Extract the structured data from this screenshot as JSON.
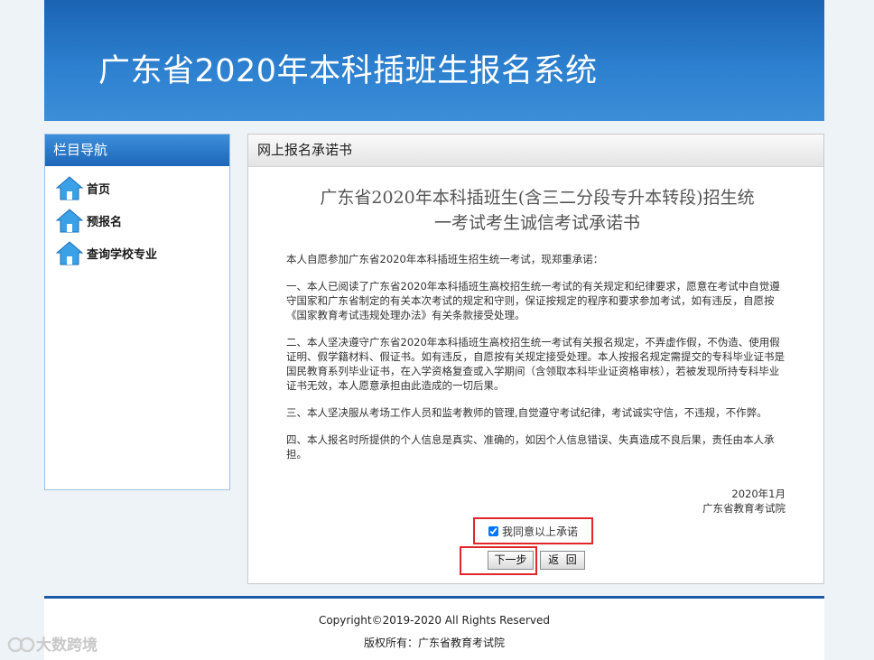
{
  "header": {
    "title": "广东省2020年本科插班生报名系统"
  },
  "nav": {
    "title": "栏目导航",
    "items": [
      {
        "label": "首页",
        "icon": "home-icon"
      },
      {
        "label": "预报名",
        "icon": "home-icon"
      },
      {
        "label": "查询学校专业",
        "icon": "home-icon"
      }
    ]
  },
  "panel": {
    "title": "网上报名承诺书",
    "doc_title_line1": "广东省2020年本科插班生(含三二分段专升本转段)招生统",
    "doc_title_line2": "一考试考生诚信考试承诺书",
    "paragraphs": [
      "本人自愿参加广东省2020年本科插班生招生统一考试，现郑重承诺：",
      "一、本人已阅读了广东省2020年本科插班生高校招生统一考试的有关规定和纪律要求，愿意在考试中自觉遵守国家和广东省制定的有关本次考试的规定和守则，保证按规定的程序和要求参加考试，如有违反，自愿按《国家教育考试违规处理办法》有关条款接受处理。",
      "二、本人坚决遵守广东省2020年本科插班生高校招生统一考试有关报名规定，不弄虚作假，不伪造、使用假证明、假学籍材料、假证书。如有违反，自愿按有关规定接受处理。本人按报名规定需提交的专科毕业证书是国民教育系列毕业证书，在入学资格复查或入学期间（含领取本科毕业证资格审核），若被发现所持专科毕业证书无效，本人愿意承担由此造成的一切后果。",
      "三、本人坚决服从考场工作人员和监考教师的管理,自觉遵守考试纪律，考试诚实守信，不违规，不作弊。",
      "四、本人报名时所提供的个人信息是真实、准确的，如因个人信息错误、失真造成不良后果，责任由本人承担。"
    ],
    "sign_date": "2020年1月",
    "sign_org": "广东省教育考试院",
    "agree_label": "我同意以上承诺",
    "agree_checked": true,
    "next_label": "下一步",
    "back_label": "返  回"
  },
  "footer": {
    "copyright": "Copyright©2019-2020 All Rights Reserved",
    "owner": "版权所有：广东省教育考试院"
  },
  "watermark": {
    "text": "大数跨境"
  },
  "colors": {
    "header": "#2c80cf",
    "accent_border": "#e0262a",
    "footer_line": "#1f5aa8"
  }
}
